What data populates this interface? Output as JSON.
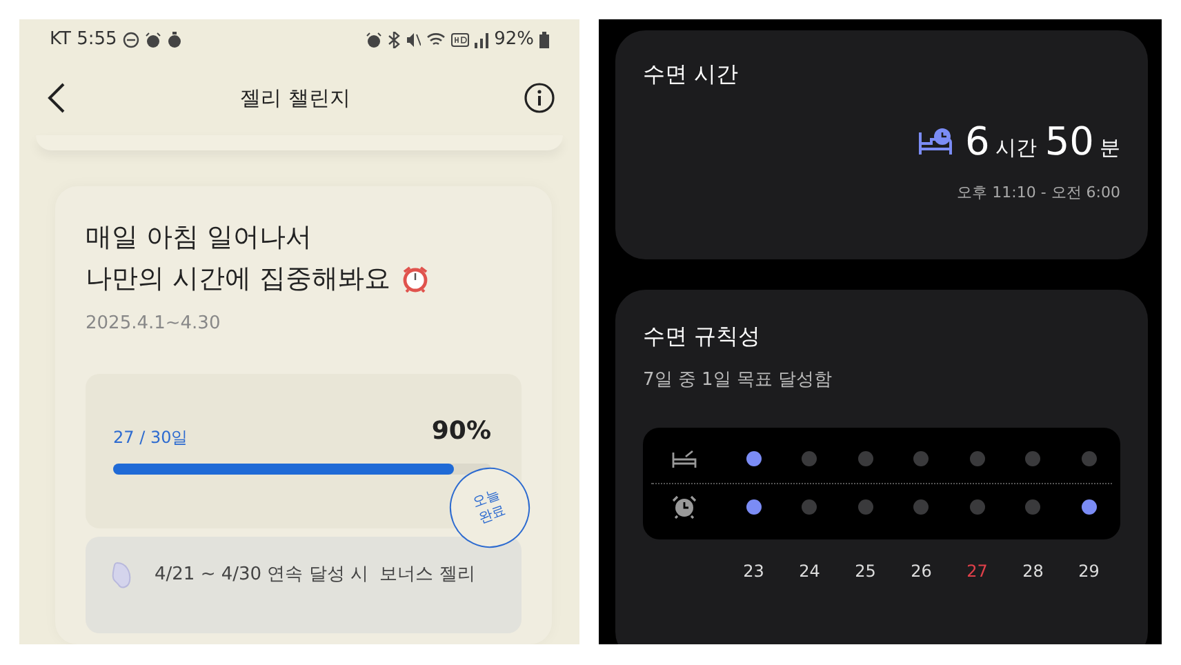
{
  "status_bar": {
    "carrier_time": "KT 5:55",
    "battery": "92%"
  },
  "header": {
    "title": "젤리 챌린지"
  },
  "challenge": {
    "title_lines": [
      "매일 아침 일어나서",
      "나만의 시간에 집중해봐요"
    ],
    "period": "2025.4.1~4.30",
    "progress": {
      "count": "27 / 30일",
      "percent": "90%",
      "level": 0.9
    },
    "stamp": {
      "lines": [
        "오늘",
        "완료"
      ]
    },
    "bonus": "4/21 ~ 4/30 연속 달성 시  보너스 젤리"
  },
  "sleep_time": {
    "title": "수면 시간",
    "hours": "6",
    "hours_unit": "시간",
    "minutes": "50",
    "minutes_unit": "분",
    "range": "오후 11:10 - 오전 6:00"
  },
  "sleep_regularity": {
    "title": "수면 규칙성",
    "summary": "7일 중 1일 목표 달성함",
    "days": [
      {
        "label": "23",
        "bedtime_met": true,
        "wake_met": true,
        "sunday": false
      },
      {
        "label": "24",
        "bedtime_met": false,
        "wake_met": false,
        "sunday": false
      },
      {
        "label": "25",
        "bedtime_met": false,
        "wake_met": false,
        "sunday": false
      },
      {
        "label": "26",
        "bedtime_met": false,
        "wake_met": false,
        "sunday": false
      },
      {
        "label": "27",
        "bedtime_met": false,
        "wake_met": false,
        "sunday": true
      },
      {
        "label": "28",
        "bedtime_met": false,
        "wake_met": false,
        "sunday": false
      },
      {
        "label": "29",
        "bedtime_met": false,
        "wake_met": true,
        "sunday": false
      }
    ]
  }
}
